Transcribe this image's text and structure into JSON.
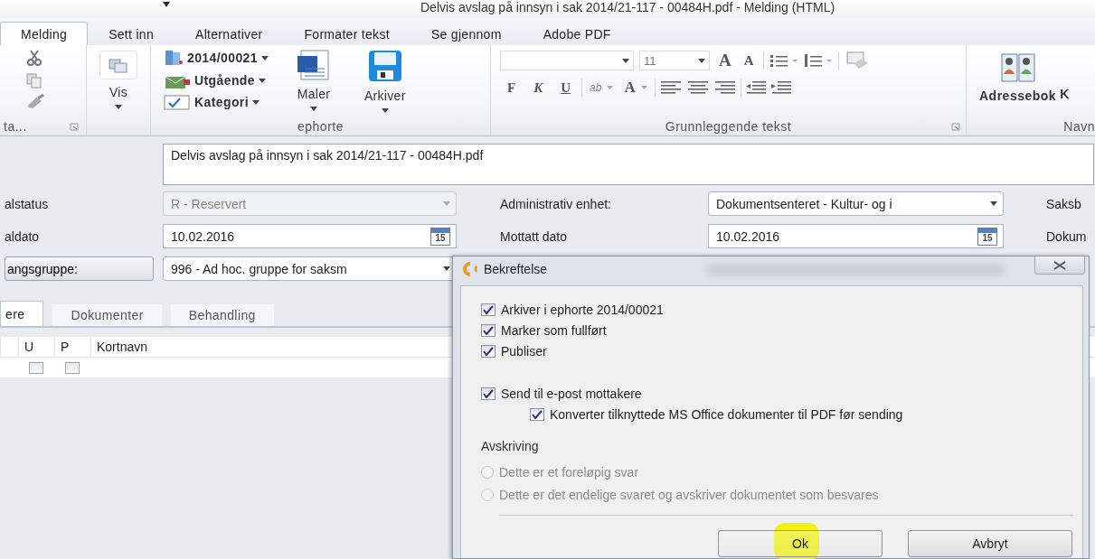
{
  "window": {
    "title": "Delvis avslag på innsyn i sak 2014/21-117 - 00484H.pdf - Melding (HTML)"
  },
  "ribbon_tabs": [
    {
      "label": "Melding",
      "selected": true
    },
    {
      "label": "Sett inn",
      "selected": false
    },
    {
      "label": "Alternativer",
      "selected": false
    },
    {
      "label": "Formater tekst",
      "selected": false
    },
    {
      "label": "Se gjennom",
      "selected": false
    },
    {
      "label": "Adobe PDF",
      "selected": false
    }
  ],
  "ribbon": {
    "clipboard": {
      "label": "ta..."
    },
    "view": {
      "label": "Vis"
    },
    "ephorte": {
      "label": "ephorte",
      "menus": [
        {
          "label": "2014/00021",
          "kind": "case"
        },
        {
          "label": "Utgående",
          "kind": "outgoing"
        },
        {
          "label": "Kategori",
          "kind": "category"
        }
      ],
      "buttons": [
        {
          "label": "Maler",
          "kind": "word"
        },
        {
          "label": "Arkiver",
          "kind": "save"
        }
      ]
    },
    "text": {
      "label": "Grunnleggende tekst",
      "font_size": "11",
      "size_buttons": [
        "A",
        "A"
      ],
      "format_buttons": [
        "F",
        "K",
        "U"
      ],
      "color_button": "A",
      "highlight_button": "ab"
    },
    "names": {
      "label": "Navn",
      "buttons": [
        "Adressebok",
        "K"
      ]
    }
  },
  "form": {
    "subject": "Delvis avslag på innsyn i sak 2014/21-117 - 00484H.pdf",
    "rows": [
      [
        {
          "kind": "label",
          "text": "alstatus"
        },
        {
          "kind": "combo",
          "value": "R - Reservert",
          "disabled": true
        },
        {
          "kind": "label",
          "text": "Administrativ enhet:"
        },
        {
          "kind": "combo",
          "value": "Dokumentsenteret - Kultur- og i",
          "disabled": false
        },
        {
          "kind": "label",
          "text": "Saksb"
        }
      ],
      [
        {
          "kind": "label",
          "text": "aldato"
        },
        {
          "kind": "date",
          "value": "10.02.2016",
          "icon_text": "15"
        },
        {
          "kind": "label",
          "text": "Mottatt dato"
        },
        {
          "kind": "date",
          "value": "10.02.2016",
          "icon_text": "15"
        },
        {
          "kind": "label",
          "text": "Dokum"
        }
      ],
      [
        {
          "kind": "button",
          "text": "angsgruppe:"
        },
        {
          "kind": "combo",
          "value": "996 - Ad hoc. gruppe for saksm",
          "disabled": false
        }
      ]
    ]
  },
  "tabs": [
    {
      "label": "ere",
      "selected": true
    },
    {
      "label": "Dokumenter",
      "selected": false
    },
    {
      "label": "Behandling",
      "selected": false
    }
  ],
  "table": {
    "columns": [
      "U",
      "P",
      "Kortnavn"
    ],
    "rows": [
      {
        "u": false,
        "p": false
      }
    ]
  },
  "dialog": {
    "title": "Bekreftelse",
    "options": [
      {
        "label": "Arkiver i ephorte 2014/00021",
        "checked": true
      },
      {
        "label": "Marker som fullført",
        "checked": true
      },
      {
        "label": "Publiser",
        "checked": true
      },
      {
        "label": "Send til e-post mottakere",
        "checked": true,
        "children": [
          {
            "label": "Konverter tilknyttede MS Office dokumenter til PDF før sending",
            "checked": true
          }
        ]
      }
    ],
    "section": "Avskriving",
    "radios": [
      {
        "label": "Dette er et foreløpig svar",
        "selected": false,
        "disabled": true
      },
      {
        "label": "Dette er det endelige svaret og avskriver dokumentet som besvares",
        "selected": false,
        "disabled": true
      }
    ],
    "buttons": [
      {
        "label": "Ok",
        "highlighted": true
      },
      {
        "label": "Avbryt",
        "highlighted": false
      }
    ]
  }
}
